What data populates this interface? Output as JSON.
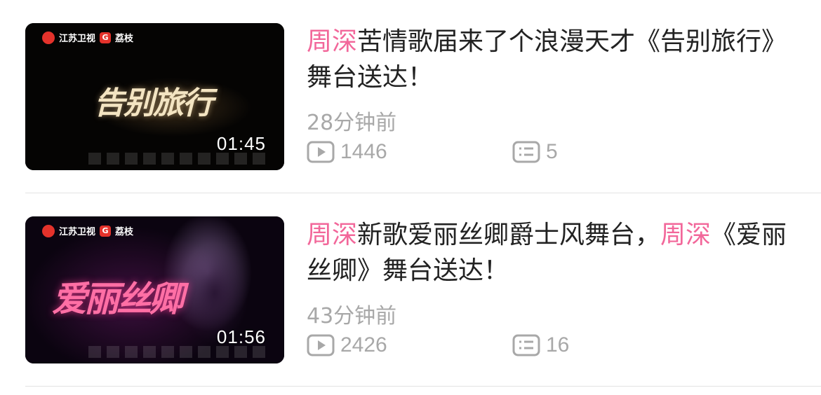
{
  "items": [
    {
      "logo_channel": "江苏卫视",
      "logo_app": "荔枝",
      "thumb_title": "告别旅行",
      "duration": "01:45",
      "title_prefix": "周深",
      "title_rest": "苦情歌届来了个浪漫天才《告别旅行》舞台送达！",
      "time_ago": "28分钟前",
      "plays": "1446",
      "comments": "5"
    },
    {
      "logo_channel": "江苏卫视",
      "logo_app": "荔枝",
      "thumb_title": "爱丽丝卿",
      "duration": "01:56",
      "title_prefix": "周深",
      "title_mid": "新歌爱丽丝卿爵士风舞台，",
      "title_prefix2": "周深",
      "title_rest": "《爱丽丝卿》舞台送达！",
      "time_ago": "43分钟前",
      "plays": "2426",
      "comments": "16"
    }
  ],
  "icons": {
    "play": "play-count-icon",
    "comment": "comment-count-icon"
  },
  "colors": {
    "highlight": "#f2679a",
    "title_text": "#222222",
    "meta_text": "#a8a8a8",
    "divider": "#e3e3e3"
  }
}
